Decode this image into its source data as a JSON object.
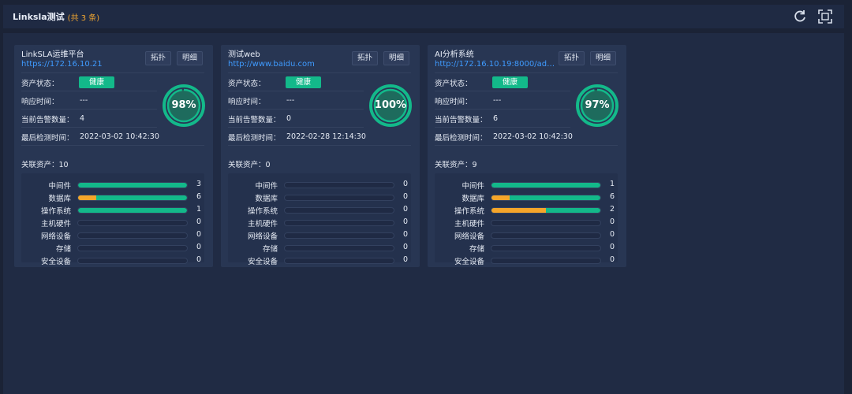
{
  "header": {
    "title": "Linksla测试",
    "count": "(共 3 条)",
    "refresh_icon": "refresh-icon",
    "fullscreen_icon": "fullscreen-icon"
  },
  "colors": {
    "healthy": "#13b98a",
    "warning": "#f5a52a",
    "url": "#3f9bff"
  },
  "labels": {
    "topo": "拓扑",
    "detail": "明细",
    "status": "资产状态：",
    "response": "响应时间：",
    "alerts": "当前告警数量：",
    "last_check": "最后检测时间：",
    "assoc": "关联资产："
  },
  "categories": [
    "中间件",
    "数据库",
    "操作系统",
    "主机硬件",
    "网络设备",
    "存储",
    "安全设备"
  ],
  "cards": [
    {
      "name": "LinkSLA运维平台",
      "url": "https://172.16.10.21",
      "status": "健康",
      "response": "---",
      "alerts": "4",
      "last_check": "2022-03-02 10:42:30",
      "gauge": "98%",
      "gauge_value": 98,
      "assoc": "10",
      "dist": [
        {
          "value": "3",
          "green": 1.0,
          "orange": 0.0
        },
        {
          "value": "6",
          "green": 1.0,
          "orange": 0.17
        },
        {
          "value": "1",
          "green": 1.0,
          "orange": 0.0
        },
        {
          "value": "0",
          "green": 0,
          "orange": 0
        },
        {
          "value": "0",
          "green": 0,
          "orange": 0
        },
        {
          "value": "0",
          "green": 0,
          "orange": 0
        },
        {
          "value": "0",
          "green": 0,
          "orange": 0
        }
      ]
    },
    {
      "name": "测试web",
      "url": "http://www.baidu.com",
      "status": "健康",
      "response": "---",
      "alerts": "0",
      "last_check": "2022-02-28 12:14:30",
      "gauge": "100%",
      "gauge_value": 100,
      "assoc": "0",
      "dist": [
        {
          "value": "0",
          "green": 0,
          "orange": 0
        },
        {
          "value": "0",
          "green": 0,
          "orange": 0
        },
        {
          "value": "0",
          "green": 0,
          "orange": 0
        },
        {
          "value": "0",
          "green": 0,
          "orange": 0
        },
        {
          "value": "0",
          "green": 0,
          "orange": 0
        },
        {
          "value": "0",
          "green": 0,
          "orange": 0
        },
        {
          "value": "0",
          "green": 0,
          "orange": 0
        }
      ]
    },
    {
      "name": "AI分析系统",
      "url": "http://172.16.10.19:8000/admi...",
      "status": "健康",
      "response": "---",
      "alerts": "6",
      "last_check": "2022-03-02 10:42:30",
      "gauge": "97%",
      "gauge_value": 97,
      "assoc": "9",
      "dist": [
        {
          "value": "1",
          "green": 1.0,
          "orange": 0.0
        },
        {
          "value": "6",
          "green": 1.0,
          "orange": 0.17
        },
        {
          "value": "2",
          "green": 1.0,
          "orange": 0.5
        },
        {
          "value": "0",
          "green": 0,
          "orange": 0
        },
        {
          "value": "0",
          "green": 0,
          "orange": 0
        },
        {
          "value": "0",
          "green": 0,
          "orange": 0
        },
        {
          "value": "0",
          "green": 0,
          "orange": 0
        }
      ]
    }
  ]
}
